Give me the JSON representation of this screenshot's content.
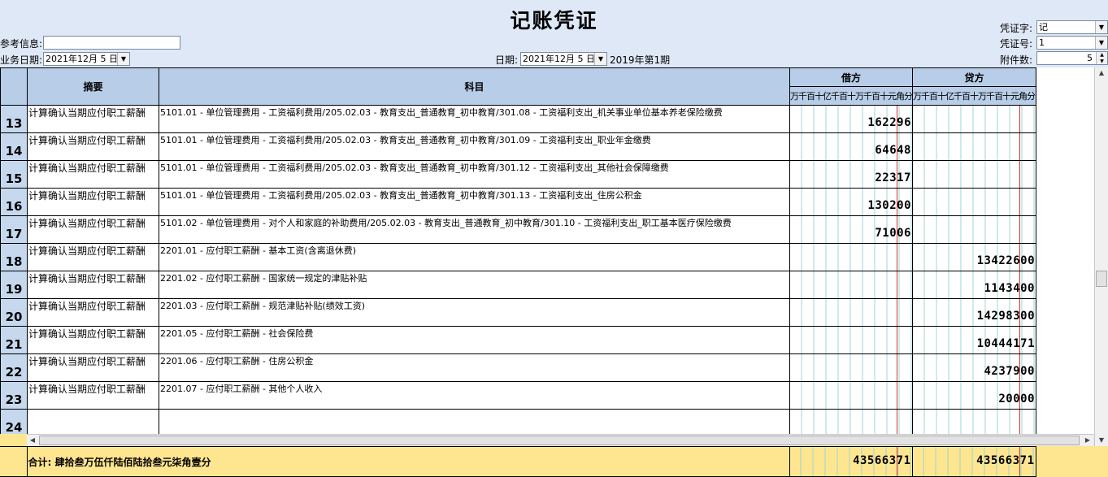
{
  "window": {
    "title": "记账凭证"
  },
  "header": {
    "ref_label": "参考信息:",
    "ref_value": "",
    "bizdate_label": "业务日期:",
    "bizdate_value": "2021年12月 5 日",
    "date_label": "日期:",
    "date_value": "2021年12月 5 日",
    "period": "2019年第1期",
    "vtype_label": "凭证字:",
    "vtype_value": "记",
    "vno_label": "凭证号:",
    "vno_value": "1",
    "attach_label": "附件数:",
    "attach_value": "5"
  },
  "table": {
    "col_summary": "摘要",
    "col_subject": "科目",
    "col_debit": "借方",
    "col_credit": "贷方",
    "digit_units": [
      "万",
      "千",
      "百",
      "十",
      "亿",
      "千",
      "百",
      "十",
      "万",
      "千",
      "百",
      "十",
      "元",
      "角",
      "分"
    ],
    "rows": [
      {
        "no": "13",
        "summary": "计算确认当期应付职工薪酬",
        "subject": "5101.01 - 单位管理费用 - 工资福利费用/205.02.03 - 教育支出_普通教育_初中教育/301.08 - 工资福利支出_机关事业单位基本养老保险缴费",
        "debit": "162296",
        "credit": ""
      },
      {
        "no": "14",
        "summary": "计算确认当期应付职工薪酬",
        "subject": "5101.01 - 单位管理费用 - 工资福利费用/205.02.03 - 教育支出_普通教育_初中教育/301.09 - 工资福利支出_职业年金缴费",
        "debit": "64648",
        "credit": ""
      },
      {
        "no": "15",
        "summary": "计算确认当期应付职工薪酬",
        "subject": "5101.01 - 单位管理费用 - 工资福利费用/205.02.03 - 教育支出_普通教育_初中教育/301.12 - 工资福利支出_其他社会保障缴费",
        "debit": "22317",
        "credit": ""
      },
      {
        "no": "16",
        "summary": "计算确认当期应付职工薪酬",
        "subject": "5101.01 - 单位管理费用 - 工资福利费用/205.02.03 - 教育支出_普通教育_初中教育/301.13 - 工资福利支出_住房公积金",
        "debit": "130200",
        "credit": ""
      },
      {
        "no": "17",
        "summary": "计算确认当期应付职工薪酬",
        "subject": "5101.02 - 单位管理费用 - 对个人和家庭的补助费用/205.02.03 - 教育支出_普通教育_初中教育/301.10 - 工资福利支出_职工基本医疗保险缴费",
        "debit": "71006",
        "credit": ""
      },
      {
        "no": "18",
        "summary": "计算确认当期应付职工薪酬",
        "subject": "2201.01 - 应付职工薪酬 - 基本工资(含离退休费)",
        "debit": "",
        "credit": "13422600"
      },
      {
        "no": "19",
        "summary": "计算确认当期应付职工薪酬",
        "subject": "2201.02 - 应付职工薪酬 - 国家统一规定的津贴补贴",
        "debit": "",
        "credit": "1143400"
      },
      {
        "no": "20",
        "summary": "计算确认当期应付职工薪酬",
        "subject": "2201.03 - 应付职工薪酬 - 规范津贴补贴(绩效工资)",
        "debit": "",
        "credit": "14298300"
      },
      {
        "no": "21",
        "summary": "计算确认当期应付职工薪酬",
        "subject": "2201.05 - 应付职工薪酬 - 社会保险费",
        "debit": "",
        "credit": "10444171"
      },
      {
        "no": "22",
        "summary": "计算确认当期应付职工薪酬",
        "subject": "2201.06 - 应付职工薪酬 - 住房公积金",
        "debit": "",
        "credit": "4237900"
      },
      {
        "no": "23",
        "summary": "计算确认当期应付职工薪酬",
        "subject": "2201.07 - 应付职工薪酬 - 其他个人收入",
        "debit": "",
        "credit": "20000"
      },
      {
        "no": "24",
        "summary": "",
        "subject": "",
        "debit": "",
        "credit": ""
      }
    ]
  },
  "footer": {
    "total_text": "合计: 肆拾叁万伍仟陆佰陆拾叁元柒角壹分",
    "debit_total": "43566371",
    "credit_total": "43566371"
  },
  "colors": {
    "header_bg": "#b7cde8",
    "footer_bg": "#fde68f",
    "page_bg": "#dfe8f6",
    "cent_line": "#d03030"
  }
}
